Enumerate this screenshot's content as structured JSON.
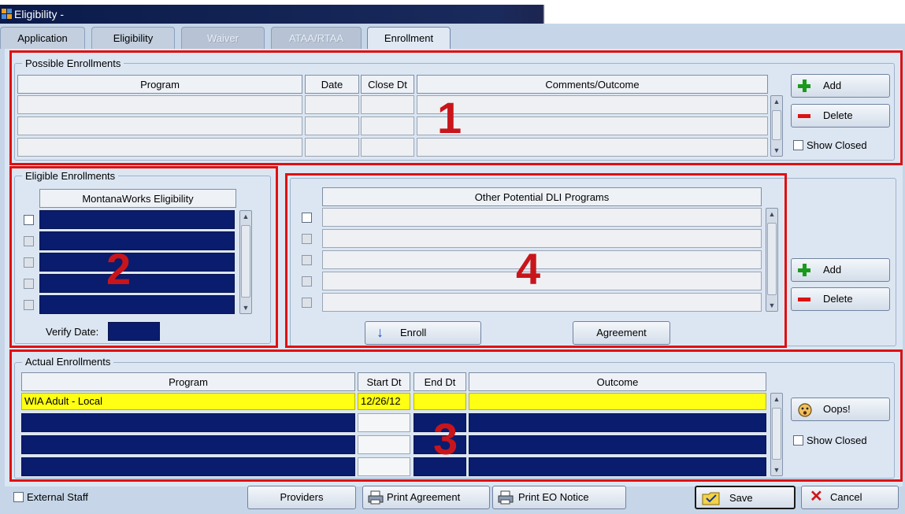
{
  "window": {
    "title": "Eligibility -"
  },
  "tabs": [
    {
      "label": "Application",
      "state": "normal"
    },
    {
      "label": "Eligibility",
      "state": "normal"
    },
    {
      "label": "Waiver",
      "state": "disabled"
    },
    {
      "label": "ATAA/RTAA",
      "state": "disabled"
    },
    {
      "label": "Enrollment",
      "state": "active"
    }
  ],
  "possible_enrollments": {
    "group_label": "Possible Enrollments",
    "columns": [
      "Program",
      "Date",
      "Close Dt",
      "Comments/Outcome"
    ],
    "rows": [
      [
        "",
        "",
        "",
        ""
      ],
      [
        "",
        "",
        "",
        ""
      ],
      [
        "",
        "",
        "",
        ""
      ]
    ],
    "add_label": "Add",
    "delete_label": "Delete",
    "show_closed_label": "Show Closed",
    "annotation": "1"
  },
  "eligible_enrollments": {
    "group_label": "Eligible Enrollments",
    "column": "MontanaWorks Eligibility",
    "rows": [
      "",
      "",
      "",
      "",
      ""
    ],
    "verify_date_label": "Verify Date:",
    "verify_date_value": "",
    "annotation": "2"
  },
  "other_programs": {
    "column": "Other Potential DLI Programs",
    "rows": [
      "",
      "",
      "",
      "",
      ""
    ],
    "enroll_label": "Enroll",
    "agreement_label": "Agreement",
    "add_label": "Add",
    "delete_label": "Delete",
    "annotation": "4"
  },
  "actual_enrollments": {
    "group_label": "Actual Enrollments",
    "columns": [
      "Program",
      "Start Dt",
      "End Dt",
      "Outcome"
    ],
    "rows": [
      [
        "WIA Adult - Local",
        "12/26/12",
        "",
        ""
      ],
      [
        "",
        "",
        "",
        ""
      ],
      [
        "",
        "",
        "",
        ""
      ],
      [
        "",
        "",
        "",
        ""
      ]
    ],
    "oops_label": "Oops!",
    "show_closed_label": "Show Closed",
    "annotation": "3"
  },
  "footer": {
    "external_staff_label": "External Staff",
    "providers_label": "Providers",
    "print_agreement_label": "Print Agreement",
    "print_eo_label": "Print EO Notice",
    "save_label": "Save",
    "cancel_label": "Cancel"
  },
  "colors": {
    "annotation_red": "#e01010",
    "field_dark": "#0a1c6e",
    "highlight_yellow": "#ffff14"
  }
}
